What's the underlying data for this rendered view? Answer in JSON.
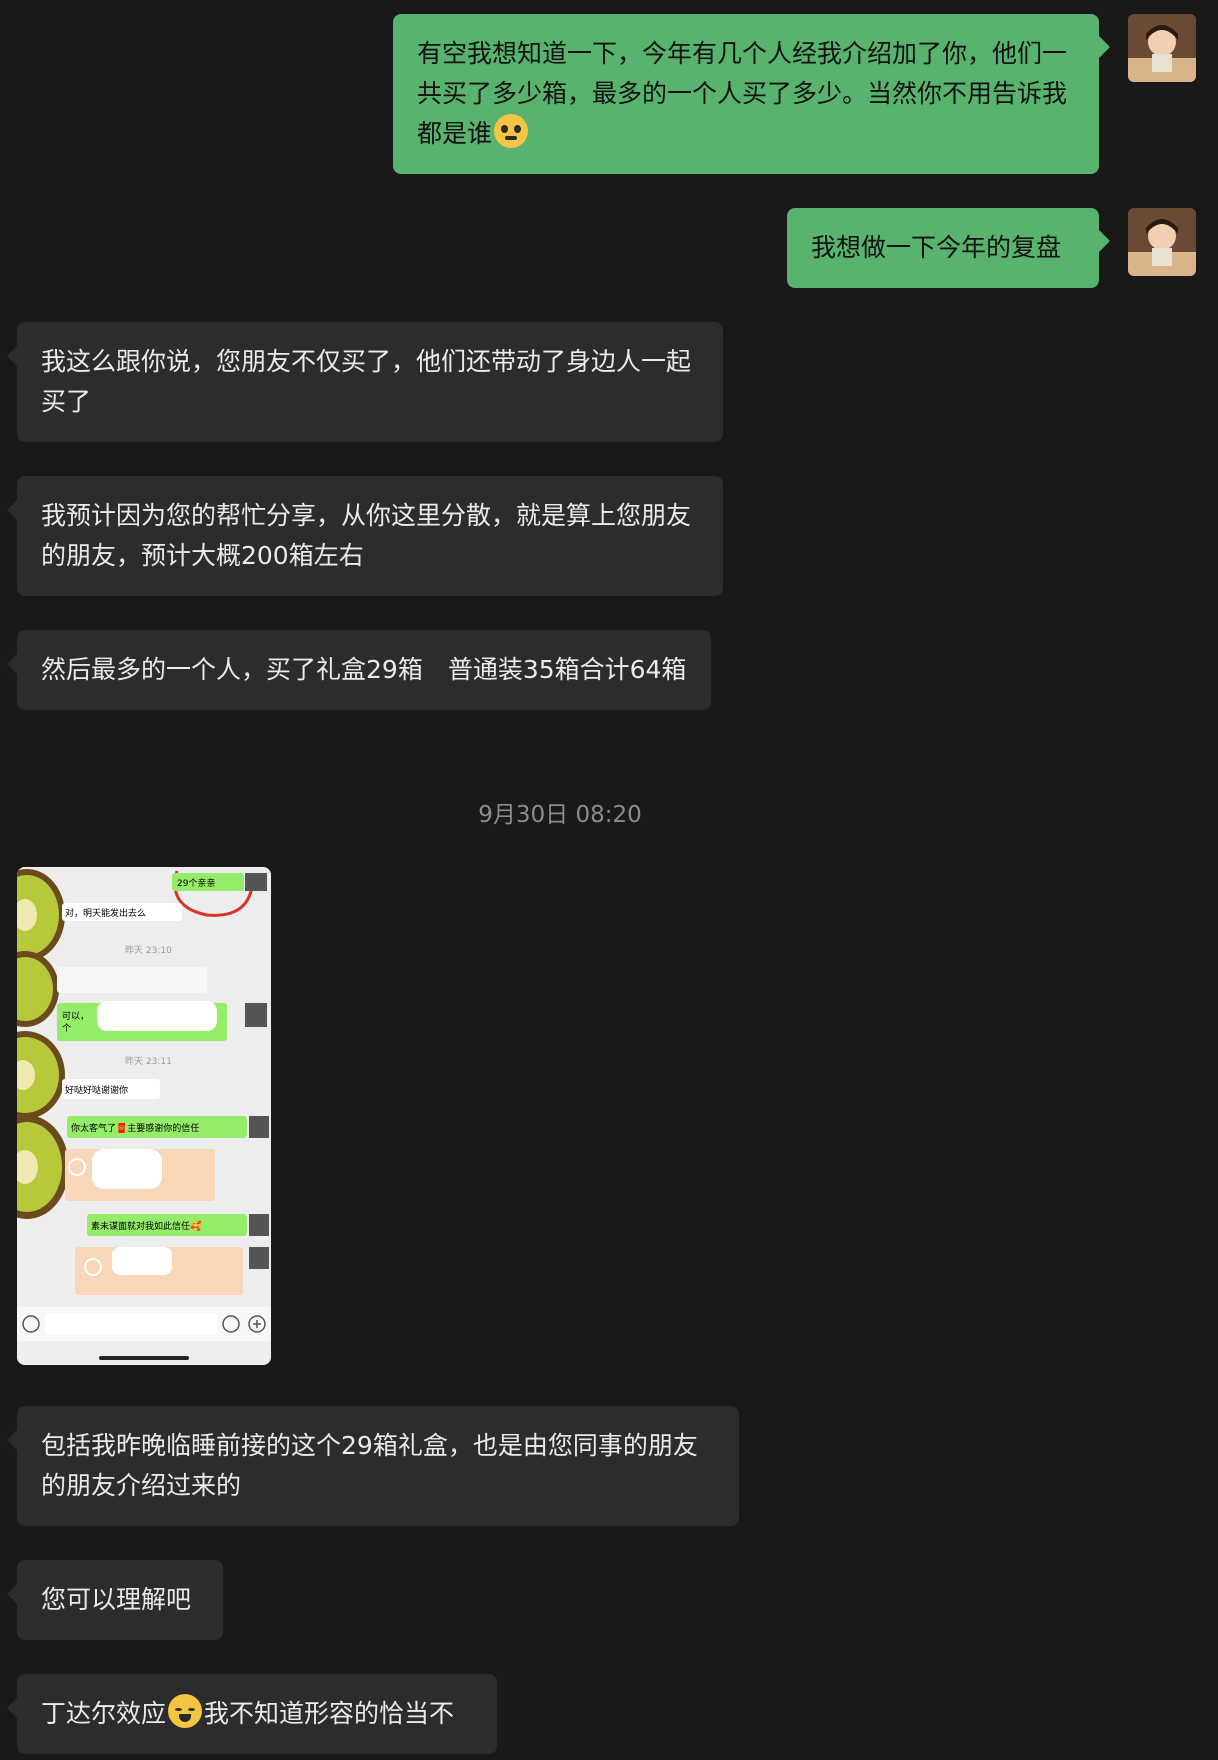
{
  "messages": [
    {
      "side": "out",
      "text": "有空我想知道一下，今年有几个人经我介绍加了你，他们一共买了多少箱，最多的一个人买了多少。当然你不用告诉我都是谁"
    },
    {
      "side": "out",
      "text": "我想做一下今年的复盘"
    },
    {
      "side": "in",
      "text": "我这么跟你说，您朋友不仅买了，他们还带动了身边人一起买了"
    },
    {
      "side": "in",
      "text": "我预计因为您的帮忙分享，从你这里分散，就是算上您朋友的朋友，预计大概200箱左右"
    },
    {
      "side": "in",
      "text": "然后最多的一个人，买了礼盒29箱　普通装35箱合计64箱"
    },
    {
      "side": "in",
      "text": "包括我昨晚临睡前接的这个29箱礼盒，也是由您同事的朋友的朋友介绍过来的"
    },
    {
      "side": "in",
      "text": "您可以理解吧"
    },
    {
      "side": "in",
      "text_before": "丁达尔效应",
      "text_after": "我不知道形容的恰当不"
    }
  ],
  "timestamp": "9月30日 08:20",
  "screenshot": {
    "labels": [
      "29个亲亲",
      "对，明天能发出去么",
      "昨天 23:10",
      "可以，",
      "个",
      "昨天 23:11",
      "好哒好哒谢谢你",
      "你太客气了🧧主要感谢你的信任",
      "素未谋面就对我如此信任🥰"
    ]
  },
  "colors": {
    "background": "#191919",
    "outgoing": "#58b36f",
    "incoming": "#2c2c2c"
  },
  "icons": [
    "smiling-face-icon",
    "laughing-tears-face-icon",
    "voice-icon",
    "emoji-icon",
    "plus-icon"
  ]
}
